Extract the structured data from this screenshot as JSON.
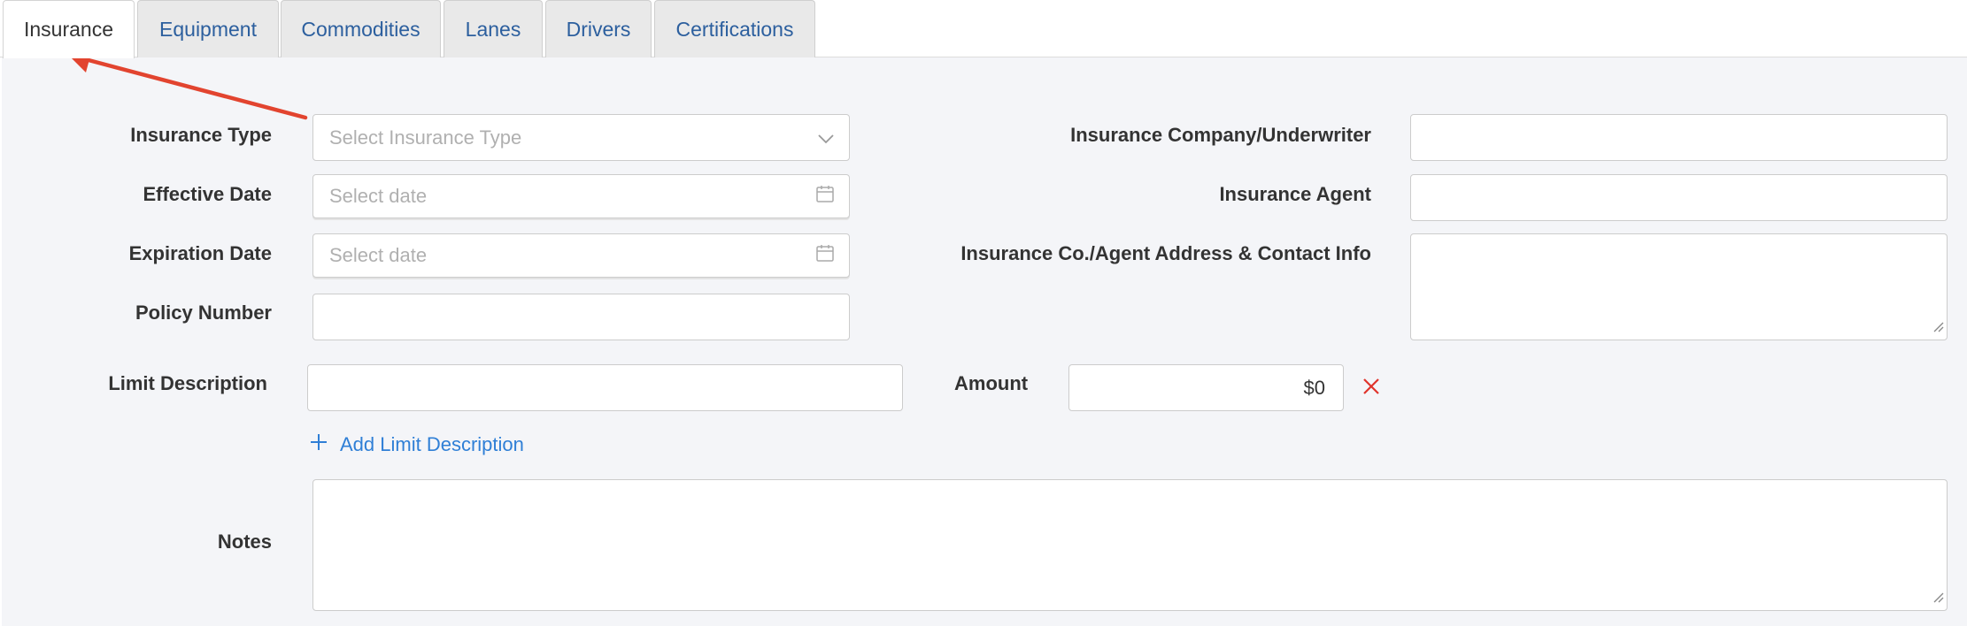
{
  "tabs": [
    {
      "label": "Insurance",
      "active": true
    },
    {
      "label": "Equipment"
    },
    {
      "label": "Commodities"
    },
    {
      "label": "Lanes"
    },
    {
      "label": "Drivers"
    },
    {
      "label": "Certifications"
    }
  ],
  "form": {
    "insurance_type": {
      "label": "Insurance Type",
      "placeholder": "Select Insurance Type"
    },
    "effective_date": {
      "label": "Effective Date",
      "placeholder": "Select date"
    },
    "expiration_date": {
      "label": "Expiration Date",
      "placeholder": "Select date"
    },
    "policy_number": {
      "label": "Policy Number",
      "value": ""
    },
    "company": {
      "label": "Insurance Company/Underwriter",
      "value": ""
    },
    "agent": {
      "label": "Insurance Agent",
      "value": ""
    },
    "address": {
      "label": "Insurance Co./Agent Address & Contact Info",
      "value": ""
    },
    "limit_description": {
      "label": "Limit Description",
      "value": ""
    },
    "amount": {
      "label": "Amount",
      "value": "$0"
    },
    "add_limit": {
      "label": "Add Limit Description"
    },
    "notes": {
      "label": "Notes",
      "value": ""
    }
  },
  "colors": {
    "link": "#2f7fd6",
    "tab_text": "#2c5f9e",
    "remove": "#e0332b",
    "annotation_arrow": "#e2442f",
    "panel_bg": "#f4f5f8"
  },
  "icons": {
    "dropdown": "chevron-down-icon",
    "date": "calendar-icon",
    "remove": "close-icon",
    "add": "plus-icon"
  }
}
